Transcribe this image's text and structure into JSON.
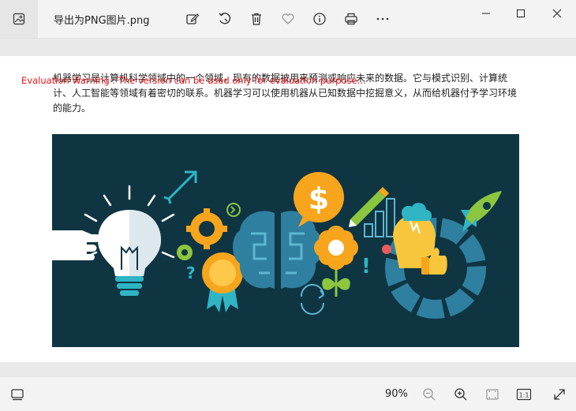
{
  "titlebar": {
    "filename": "导出为PNG图片.png"
  },
  "document": {
    "paragraph": "机器学习是计算机科学领域中的一个领域，现有的数据被用来预测或响应未来的数据。它与模式识别、计算统计、人工智能等领域有着密切的联系。机器学习可以使用机器从已知数据中挖掘意义，从而给机器付予学习环境的能力。",
    "warning": "Evaluation Warning : The version can be used only for evaluation purpose..."
  },
  "illustration": {
    "dollar_symbol": "$",
    "question_mark": "?",
    "exclamation_mark": "!"
  },
  "statusbar": {
    "zoom": "90%",
    "actual_size_label": "1:1"
  },
  "colors": {
    "image_background": "#0f3543",
    "warning_text": "#e8171a",
    "accent_orange": "#f7a51c",
    "accent_teal": "#2fb5c4",
    "accent_green": "#8cc63f"
  }
}
